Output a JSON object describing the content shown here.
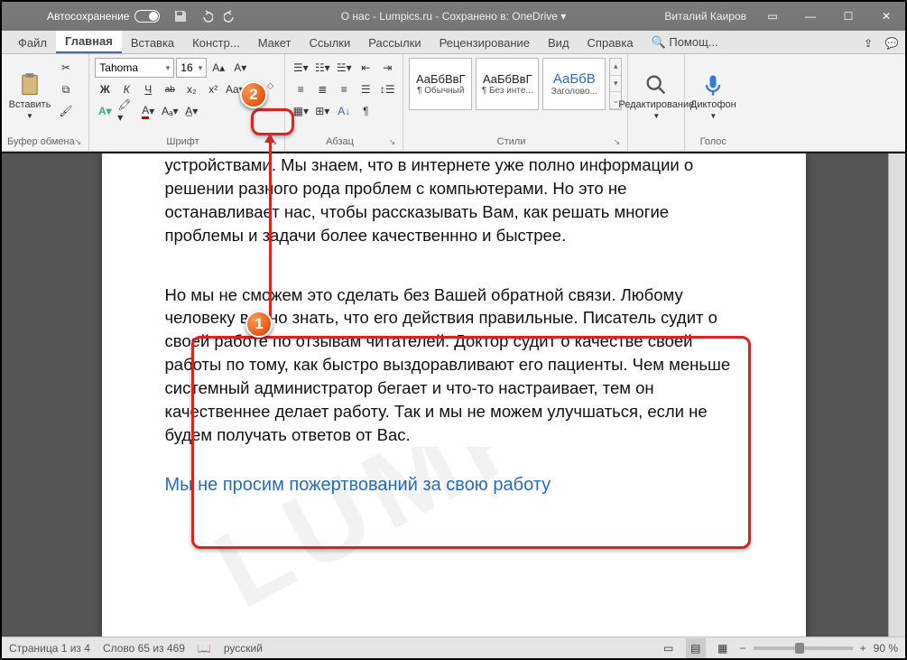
{
  "titlebar": {
    "autosave": "Автосохранение",
    "doc_title": "О нас - Lumpics.ru - Сохранено в: OneDrive ▾",
    "user": "Виталий Каиров"
  },
  "tabs": {
    "file": "Файл",
    "home": "Главная",
    "insert": "Вставка",
    "design": "Констр...",
    "layout": "Макет",
    "references": "Ссылки",
    "mailing": "Рассылки",
    "review": "Рецензирование",
    "view": "Вид",
    "help": "Справка",
    "search": "Помощ..."
  },
  "ribbon": {
    "clipboard": {
      "paste": "Вставить",
      "label": "Буфер обмена"
    },
    "font": {
      "name": "Tahoma",
      "size": "16",
      "label": "Шрифт",
      "bold": "Ж",
      "italic": "К",
      "underline": "Ч",
      "strike": "ab",
      "sub": "x₂",
      "sup": "x²"
    },
    "paragraph": {
      "label": "Абзац"
    },
    "styles": {
      "label": "Стили",
      "s1_prev": "АаБбВвГ",
      "s1_name": "¶ Обычный",
      "s2_prev": "АаБбВвГ",
      "s2_name": "¶ Без инте...",
      "s3_prev": "АаБбВ",
      "s3_name": "Заголово..."
    },
    "editing": {
      "label": "Редактирование"
    },
    "voice": {
      "label": "Голос",
      "btn": "Диктофон"
    }
  },
  "doc": {
    "p1": "устройствами. Мы знаем, что в интернете уже полно информации о решении разного рода проблем с компьютерами. Но это не останавливает нас, чтобы рассказывать Вам, как решать многие проблемы и задачи более качественнно и быстрее.",
    "p2": "Но мы не сможем это сделать без Вашей обратной связи. Любому человеку важно знать, что его действия правильные. Писатель судит о своей работе по отзывам читателей. Доктор судит о качестве своей работы по тому, как быстро выздоравливают его пациенты. Чем меньше системный администратор бегает и что-то настраивает, тем он качественнее делает работу. Так и мы не можем улучшаться, если не будем получать ответов от Вас.",
    "h2": "Мы не просим пожертвований за свою работу"
  },
  "status": {
    "page": "Страница 1 из 4",
    "words": "Слово 65 из 469",
    "lang": "русский",
    "zoom": "90 %"
  },
  "callouts": {
    "one": "1",
    "two": "2"
  }
}
